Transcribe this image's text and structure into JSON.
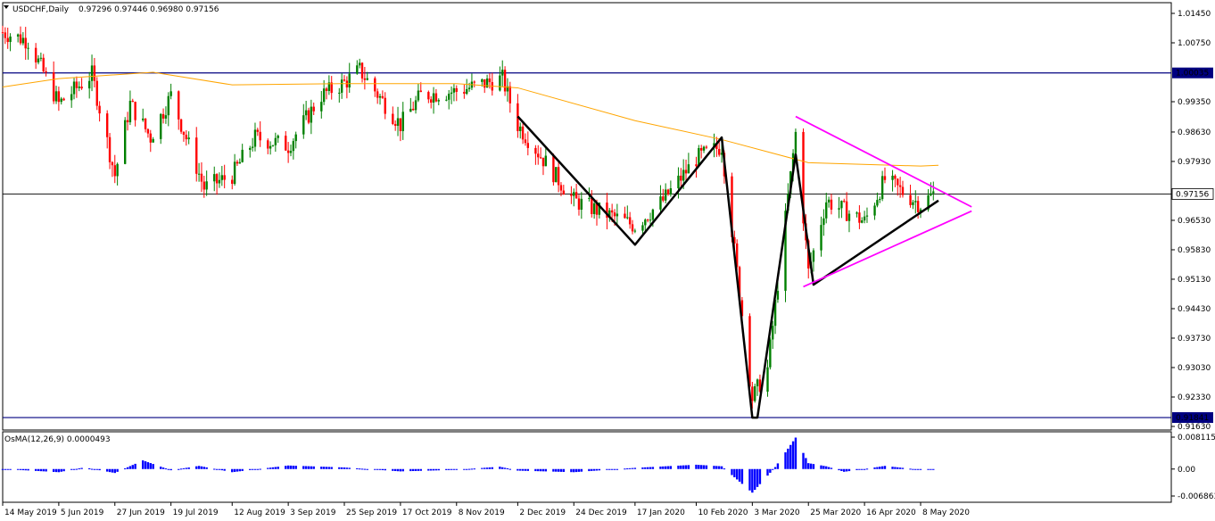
{
  "header": {
    "symbol": "USDCHF,Daily",
    "ohlc": "0.97296 0.97446 0.96980 0.97156",
    "menu_icon": "triangle-down-icon"
  },
  "indicator": {
    "label": "OsMA(12,26,9) 0.0000493",
    "ticks": [
      "0.0081156",
      "0.00",
      "-0.006863"
    ]
  },
  "colors": {
    "bull": "#008000",
    "bear": "#ff0000",
    "ma": "#ffa500",
    "level": "#000080",
    "pattern": "#000000",
    "triangle": "#ff00ff",
    "osma": "#0000ff"
  },
  "chart_data": [
    {
      "type": "candlestick",
      "title": "USDCHF,Daily",
      "ylim": [
        0.9163,
        1.0145
      ],
      "y_ticks": [
        "1.01450",
        "1.00750",
        "0.99350",
        "0.98630",
        "0.97930",
        "0.96530",
        "0.95830",
        "0.95130",
        "0.94430",
        "0.93730",
        "0.93030",
        "0.92330",
        "0.91630"
      ],
      "x_ticks": [
        "14 May 2019",
        "5 Jun 2019",
        "27 Jun 2019",
        "19 Jul 2019",
        "12 Aug 2019",
        "3 Sep 2019",
        "25 Sep 2019",
        "17 Oct 2019",
        "8 Nov 2019",
        "2 Dec 2019",
        "24 Dec 2019",
        "17 Jan 2020",
        "10 Feb 2020",
        "3 Mar 2020",
        "25 Mar 2020",
        "16 Apr 2020",
        "8 May 2020"
      ],
      "horizontal_levels": [
        {
          "price": 1.00035,
          "label": "1.00035"
        },
        {
          "price": 0.91841,
          "label": "0.91841"
        }
      ],
      "current_price": {
        "price": 0.97156,
        "label": "0.97156"
      },
      "close_path": [
        {
          "x": "14 May 2019",
          "y": 1.01
        },
        {
          "x": "24 May 2019",
          "y": 1.008
        },
        {
          "x": "5 Jun 2019",
          "y": 0.993
        },
        {
          "x": "18 Jun 2019",
          "y": 1.0
        },
        {
          "x": "27 Jun 2019",
          "y": 0.976
        },
        {
          "x": "3 Jul 2019",
          "y": 0.993
        },
        {
          "x": "11 Jul 2019",
          "y": 0.985
        },
        {
          "x": "19 Jul 2019",
          "y": 0.995
        },
        {
          "x": "1 Aug 2019",
          "y": 0.973
        },
        {
          "x": "12 Aug 2019",
          "y": 0.976
        },
        {
          "x": "21 Aug 2019",
          "y": 0.985
        },
        {
          "x": "3 Sep 2019",
          "y": 0.983
        },
        {
          "x": "16 Sep 2019",
          "y": 0.995
        },
        {
          "x": "25 Sep 2019",
          "y": 0.998
        },
        {
          "x": "1 Oct 2019",
          "y": 1.001
        },
        {
          "x": "17 Oct 2019",
          "y": 0.988
        },
        {
          "x": "25 Oct 2019",
          "y": 0.995
        },
        {
          "x": "8 Nov 2019",
          "y": 0.996
        },
        {
          "x": "26 Nov 2019",
          "y": 0.999
        },
        {
          "x": "2 Dec 2019",
          "y": 0.988
        },
        {
          "x": "24 Dec 2019",
          "y": 0.97
        },
        {
          "x": "17 Jan 2020",
          "y": 0.964
        },
        {
          "x": "28 Jan 2020",
          "y": 0.97
        },
        {
          "x": "10 Feb 2020",
          "y": 0.98
        },
        {
          "x": "20 Feb 2020",
          "y": 0.983
        },
        {
          "x": "3 Mar 2020",
          "y": 0.923
        },
        {
          "x": "9 Mar 2020",
          "y": 0.93
        },
        {
          "x": "20 Mar 2020",
          "y": 0.986
        },
        {
          "x": "25 Mar 2020",
          "y": 0.953
        },
        {
          "x": "1 Apr 2020",
          "y": 0.97
        },
        {
          "x": "16 Apr 2020",
          "y": 0.965
        },
        {
          "x": "24 Apr 2020",
          "y": 0.975
        },
        {
          "x": "8 May 2020",
          "y": 0.969
        },
        {
          "x": "13 May 2020",
          "y": 0.9716
        }
      ],
      "moving_average": [
        {
          "x": "14 May 2019",
          "y": 0.997
        },
        {
          "x": "5 Jun 2019",
          "y": 0.999
        },
        {
          "x": "12 Jul 2019",
          "y": 1.0005
        },
        {
          "x": "12 Aug 2019",
          "y": 0.9975
        },
        {
          "x": "25 Sep 2019",
          "y": 0.9978
        },
        {
          "x": "8 Nov 2019",
          "y": 0.9978
        },
        {
          "x": "2 Dec 2019",
          "y": 0.9968
        },
        {
          "x": "17 Jan 2020",
          "y": 0.989
        },
        {
          "x": "20 Feb 2020",
          "y": 0.9845
        },
        {
          "x": "25 Mar 2020",
          "y": 0.979
        },
        {
          "x": "8 May 2020",
          "y": 0.9782
        },
        {
          "x": "15 May 2020",
          "y": 0.9784
        }
      ],
      "pattern_lines": [
        {
          "x": "2 Dec 2019",
          "y": 0.99
        },
        {
          "x": "17 Jan 2020",
          "y": 0.9595
        },
        {
          "x": "20 Feb 2020",
          "y": 0.985
        },
        {
          "x": "3 Mar 2020",
          "y": 0.9184
        },
        {
          "x": "5 Mar 2020",
          "y": 0.9184
        },
        {
          "x": "20 Mar 2020",
          "y": 0.981
        },
        {
          "x": "27 Mar 2020",
          "y": 0.95
        },
        {
          "x": "15 May 2020",
          "y": 0.97
        }
      ],
      "triangle_lines": [
        [
          {
            "x": "20 Mar 2020",
            "y": 0.99
          },
          {
            "x": "28 May 2020",
            "y": 0.9685
          }
        ],
        [
          {
            "x": "23 Mar 2020",
            "y": 0.9495
          },
          {
            "x": "28 May 2020",
            "y": 0.9675
          }
        ]
      ]
    },
    {
      "type": "bar",
      "title": "OsMA(12,26,9) 0.0000493",
      "ylim": [
        -0.006863,
        0.0081156
      ],
      "values_path": [
        {
          "x": "14 May 2019",
          "y": 0.0
        },
        {
          "x": "5 Jun 2019",
          "y": -0.0008
        },
        {
          "x": "15 Jun 2019",
          "y": 0.0004
        },
        {
          "x": "27 Jun 2019",
          "y": -0.001
        },
        {
          "x": "8 Jul 2019",
          "y": 0.0022
        },
        {
          "x": "19 Jul 2019",
          "y": -0.0003
        },
        {
          "x": "30 Jul 2019",
          "y": 0.0008
        },
        {
          "x": "12 Aug 2019",
          "y": -0.0008
        },
        {
          "x": "3 Sep 2019",
          "y": 0.0009
        },
        {
          "x": "25 Sep 2019",
          "y": 0.0004
        },
        {
          "x": "17 Oct 2019",
          "y": -0.0006
        },
        {
          "x": "8 Nov 2019",
          "y": -0.0002
        },
        {
          "x": "25 Nov 2019",
          "y": 0.0006
        },
        {
          "x": "2 Dec 2019",
          "y": -0.0004
        },
        {
          "x": "24 Dec 2019",
          "y": -0.0008
        },
        {
          "x": "17 Jan 2020",
          "y": 0.0003
        },
        {
          "x": "10 Feb 2020",
          "y": 0.0011
        },
        {
          "x": "20 Feb 2020",
          "y": 0.0007
        },
        {
          "x": "3 Mar 2020",
          "y": -0.006
        },
        {
          "x": "12 Mar 2020",
          "y": 0.0005
        },
        {
          "x": "20 Mar 2020",
          "y": 0.008
        },
        {
          "x": "25 Mar 2020",
          "y": 0.0015
        },
        {
          "x": "1 Apr 2020",
          "y": 0.0007
        },
        {
          "x": "8 Apr 2020",
          "y": -0.0007
        },
        {
          "x": "16 Apr 2020",
          "y": 0.0
        },
        {
          "x": "24 Apr 2020",
          "y": 0.0008
        },
        {
          "x": "8 May 2020",
          "y": -0.0002
        },
        {
          "x": "13 May 2020",
          "y": 0.0
        }
      ]
    }
  ]
}
